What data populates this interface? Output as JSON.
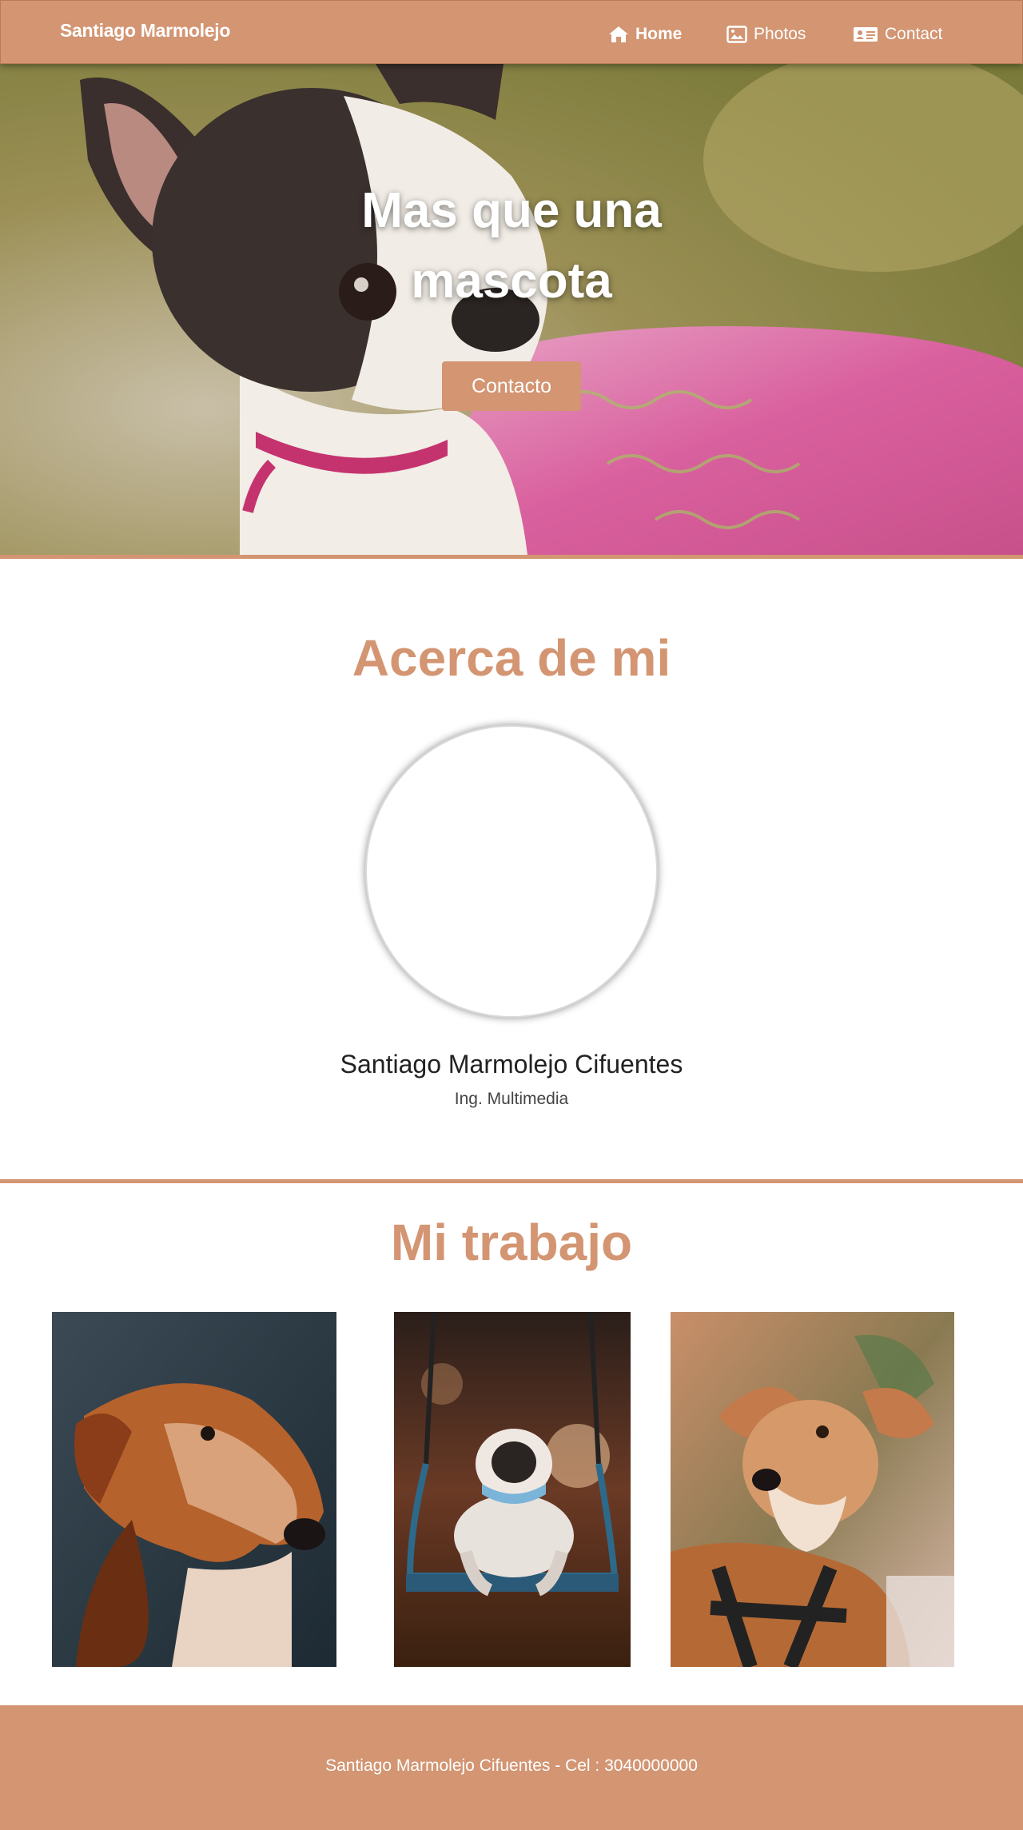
{
  "navbar": {
    "brand": "Santiago Marmolejo",
    "items": [
      {
        "label": "Home",
        "icon": "home-icon",
        "active": true
      },
      {
        "label": "Photos",
        "icon": "image-icon",
        "active": false
      },
      {
        "label": "Contact",
        "icon": "id-card-icon",
        "active": false
      }
    ]
  },
  "hero": {
    "title_line1": "Mas que una",
    "title_line2": "mascota",
    "button_label": "Contacto"
  },
  "about": {
    "title": "Acerca de mi",
    "name": "Santiago Marmolejo Cifuentes",
    "role": "Ing. Multimedia"
  },
  "work": {
    "title": "Mi trabajo",
    "photos": [
      "dog-portrait-photo",
      "pug-on-swing-photo",
      "dog-with-harness-photo"
    ]
  },
  "footer": {
    "text": "Santiago Marmolejo Cifuentes - Cel : 3040000000"
  },
  "colors": {
    "accent": "#d39572",
    "white": "#ffffff"
  }
}
